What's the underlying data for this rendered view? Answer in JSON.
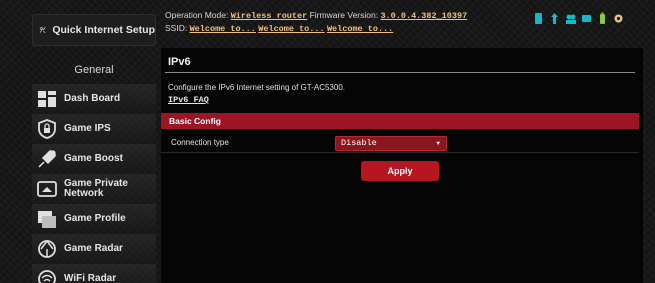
{
  "sidebar": {
    "quick_setup_label": "Quick Internet Setup",
    "section_title": "General",
    "items": [
      {
        "label": "Dash Board",
        "icon": "dashboard-icon"
      },
      {
        "label": "Game IPS",
        "icon": "game-ips-icon"
      },
      {
        "label": "Game Boost",
        "icon": "game-boost-icon"
      },
      {
        "label": "Game Private Network",
        "icon": "game-private-network-icon"
      },
      {
        "label": "Game Profile",
        "icon": "game-profile-icon"
      },
      {
        "label": "Game Radar",
        "icon": "game-radar-icon"
      },
      {
        "label": "WiFi Radar",
        "icon": "wifi-radar-icon"
      }
    ]
  },
  "header": {
    "operation_mode_label": "Operation Mode:",
    "operation_mode_value": "Wireless router",
    "firmware_label": "Firmware Version:",
    "firmware_value": "3.0.0.4.382_10397",
    "ssid_label": "SSID:",
    "ssids": [
      "Welcome to...",
      "Welcome to...",
      "Welcome to..."
    ],
    "status_icons": [
      "network-status-icon",
      "usb-status-icon",
      "users-status-icon",
      "device-status-icon",
      "battery-status-icon",
      "settings-status-icon"
    ]
  },
  "main": {
    "title": "IPv6",
    "description": "Configure the IPv6 Internet setting of GT-AC5300.",
    "faq_link": "IPv6 FAQ",
    "section_title": "Basic Config",
    "connection_type_label": "Connection type",
    "connection_type_value": "Disable",
    "apply_label": "Apply"
  },
  "colors": {
    "accent": "#9c1523",
    "button": "#b5161f",
    "highlight": "#f0c27a"
  }
}
